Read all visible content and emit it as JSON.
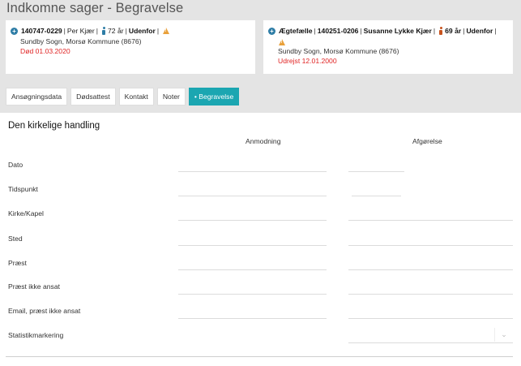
{
  "page": {
    "title": "Indkomne sager - Begravelse"
  },
  "cards": [
    {
      "id": "140747-0229",
      "name": "Per Kjær",
      "gender": "male",
      "age": "72 år",
      "status": "Udenfor",
      "parish": "Sundby Sogn, Morsø Kommune (8676)",
      "note": "Død 01.03.2020"
    },
    {
      "relation": "Ægtefælle",
      "id": "140251-0206",
      "name": "Susanne Lykke Kjær",
      "gender": "female",
      "age": "69 år",
      "status": "Udenfor",
      "parish": "Sundby Sogn, Morsø Kommune (8676)",
      "note": "Udrejst 12.01.2000"
    }
  ],
  "tabs": [
    "Ansøgningsdata",
    "Dødsattest",
    "Kontakt",
    "Noter",
    "Begravelse"
  ],
  "active_tab": "Begravelse",
  "section": {
    "title": "Den kirkelige handling",
    "col_request": "Anmodning",
    "col_decision": "Afgørelse",
    "rows": [
      "Dato",
      "Tidspunkt",
      "Kirke/Kapel",
      "Sted",
      "Præst",
      "Præst ikke ansat",
      "Email, præst ikke ansat",
      "Statistikmarkering"
    ]
  },
  "icons": {
    "select_arrow": "chevron-down-icon"
  },
  "colors": {
    "accent": "#1ba6b1",
    "alert": "#e02424",
    "warning": "#e9a13b",
    "male": "#2e7da6",
    "female": "#c8531e"
  }
}
